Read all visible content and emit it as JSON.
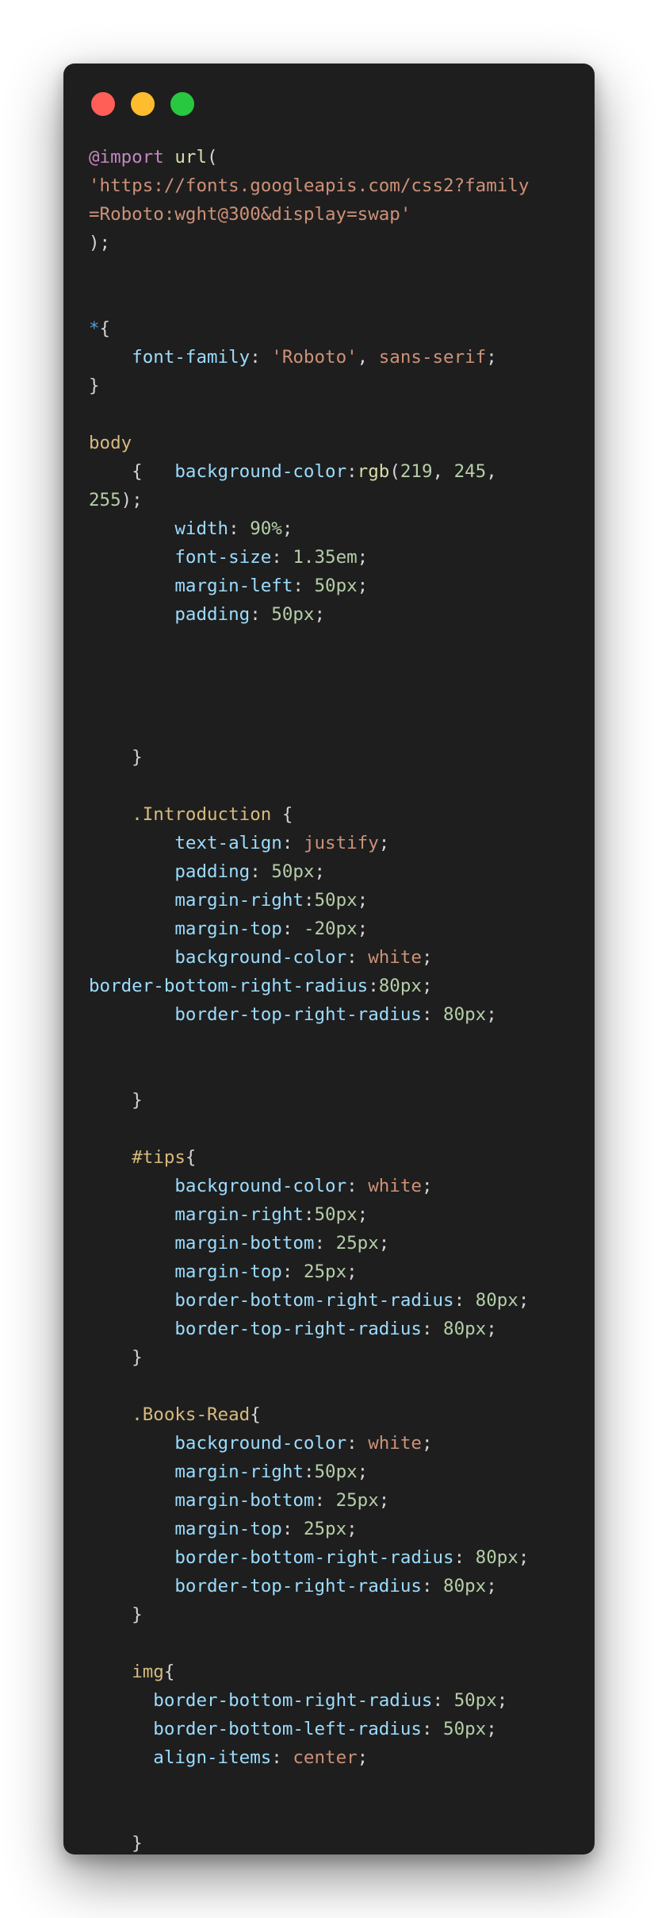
{
  "window": {
    "controls": [
      {
        "name": "close-button",
        "color": "#ff5f57"
      },
      {
        "name": "minimize-button",
        "color": "#febc2e"
      },
      {
        "name": "zoom-button",
        "color": "#28c840"
      }
    ]
  },
  "colors": {
    "background": "#1e1e1e",
    "at_rule": "#c586c0",
    "function": "#dcdcaa",
    "string": "#ce9178",
    "punct": "#d4d4d4",
    "selector": "#d7ba7d",
    "universal": "#569cd6",
    "property": "#9cdcfe",
    "keyword": "#ce9178",
    "number": "#b5cea8"
  },
  "code": {
    "lines": [
      [
        {
          "t": "@import",
          "c": "at_rule"
        },
        {
          "t": " ",
          "c": "punct"
        },
        {
          "t": "url",
          "c": "function"
        },
        {
          "t": "(",
          "c": "punct"
        }
      ],
      [
        {
          "t": "'https://fonts.googleapis.com/css2?family",
          "c": "string"
        }
      ],
      [
        {
          "t": "=Roboto:wght@300&display=swap'",
          "c": "string"
        }
      ],
      [
        {
          "t": ");",
          "c": "punct"
        }
      ],
      [],
      [],
      [
        {
          "t": "*",
          "c": "universal"
        },
        {
          "t": "{",
          "c": "punct"
        }
      ],
      [
        {
          "t": "    ",
          "c": "punct"
        },
        {
          "t": "font-family",
          "c": "property"
        },
        {
          "t": ": ",
          "c": "punct"
        },
        {
          "t": "'Roboto'",
          "c": "string"
        },
        {
          "t": ", ",
          "c": "punct"
        },
        {
          "t": "sans-serif",
          "c": "keyword"
        },
        {
          "t": ";",
          "c": "punct"
        }
      ],
      [
        {
          "t": "}",
          "c": "punct"
        }
      ],
      [],
      [
        {
          "t": "body",
          "c": "selector"
        }
      ],
      [
        {
          "t": "    {   ",
          "c": "punct"
        },
        {
          "t": "background-color",
          "c": "property"
        },
        {
          "t": ":",
          "c": "punct"
        },
        {
          "t": "rgb",
          "c": "function"
        },
        {
          "t": "(",
          "c": "punct"
        },
        {
          "t": "219",
          "c": "number"
        },
        {
          "t": ", ",
          "c": "punct"
        },
        {
          "t": "245",
          "c": "number"
        },
        {
          "t": ",",
          "c": "punct"
        }
      ],
      [
        {
          "t": "255",
          "c": "number"
        },
        {
          "t": ");",
          "c": "punct"
        }
      ],
      [
        {
          "t": "        ",
          "c": "punct"
        },
        {
          "t": "width",
          "c": "property"
        },
        {
          "t": ": ",
          "c": "punct"
        },
        {
          "t": "90%",
          "c": "number"
        },
        {
          "t": ";",
          "c": "punct"
        }
      ],
      [
        {
          "t": "        ",
          "c": "punct"
        },
        {
          "t": "font-size",
          "c": "property"
        },
        {
          "t": ": ",
          "c": "punct"
        },
        {
          "t": "1.35em",
          "c": "number"
        },
        {
          "t": ";",
          "c": "punct"
        }
      ],
      [
        {
          "t": "        ",
          "c": "punct"
        },
        {
          "t": "margin-left",
          "c": "property"
        },
        {
          "t": ": ",
          "c": "punct"
        },
        {
          "t": "50px",
          "c": "number"
        },
        {
          "t": ";",
          "c": "punct"
        }
      ],
      [
        {
          "t": "        ",
          "c": "punct"
        },
        {
          "t": "padding",
          "c": "property"
        },
        {
          "t": ": ",
          "c": "punct"
        },
        {
          "t": "50px",
          "c": "number"
        },
        {
          "t": ";",
          "c": "punct"
        }
      ],
      [],
      [],
      [],
      [],
      [
        {
          "t": "    }",
          "c": "punct"
        }
      ],
      [],
      [
        {
          "t": "    ",
          "c": "punct"
        },
        {
          "t": ".Introduction",
          "c": "selector"
        },
        {
          "t": " {",
          "c": "punct"
        }
      ],
      [
        {
          "t": "        ",
          "c": "punct"
        },
        {
          "t": "text-align",
          "c": "property"
        },
        {
          "t": ": ",
          "c": "punct"
        },
        {
          "t": "justify",
          "c": "keyword"
        },
        {
          "t": ";",
          "c": "punct"
        }
      ],
      [
        {
          "t": "        ",
          "c": "punct"
        },
        {
          "t": "padding",
          "c": "property"
        },
        {
          "t": ": ",
          "c": "punct"
        },
        {
          "t": "50px",
          "c": "number"
        },
        {
          "t": ";",
          "c": "punct"
        }
      ],
      [
        {
          "t": "        ",
          "c": "punct"
        },
        {
          "t": "margin-right",
          "c": "property"
        },
        {
          "t": ":",
          "c": "punct"
        },
        {
          "t": "50px",
          "c": "number"
        },
        {
          "t": ";",
          "c": "punct"
        }
      ],
      [
        {
          "t": "        ",
          "c": "punct"
        },
        {
          "t": "margin-top",
          "c": "property"
        },
        {
          "t": ": ",
          "c": "punct"
        },
        {
          "t": "-20px",
          "c": "number"
        },
        {
          "t": ";",
          "c": "punct"
        }
      ],
      [
        {
          "t": "        ",
          "c": "punct"
        },
        {
          "t": "background-color",
          "c": "property"
        },
        {
          "t": ": ",
          "c": "punct"
        },
        {
          "t": "white",
          "c": "keyword"
        },
        {
          "t": ";",
          "c": "punct"
        }
      ],
      [
        {
          "t": "border-bottom-right-radius",
          "c": "property"
        },
        {
          "t": ":",
          "c": "punct"
        },
        {
          "t": "80px",
          "c": "number"
        },
        {
          "t": ";",
          "c": "punct"
        }
      ],
      [
        {
          "t": "        ",
          "c": "punct"
        },
        {
          "t": "border-top-right-radius",
          "c": "property"
        },
        {
          "t": ": ",
          "c": "punct"
        },
        {
          "t": "80px",
          "c": "number"
        },
        {
          "t": ";",
          "c": "punct"
        }
      ],
      [],
      [],
      [
        {
          "t": "    }",
          "c": "punct"
        }
      ],
      [],
      [
        {
          "t": "    ",
          "c": "punct"
        },
        {
          "t": "#tips",
          "c": "selector"
        },
        {
          "t": "{",
          "c": "punct"
        }
      ],
      [
        {
          "t": "        ",
          "c": "punct"
        },
        {
          "t": "background-color",
          "c": "property"
        },
        {
          "t": ": ",
          "c": "punct"
        },
        {
          "t": "white",
          "c": "keyword"
        },
        {
          "t": ";",
          "c": "punct"
        }
      ],
      [
        {
          "t": "        ",
          "c": "punct"
        },
        {
          "t": "margin-right",
          "c": "property"
        },
        {
          "t": ":",
          "c": "punct"
        },
        {
          "t": "50px",
          "c": "number"
        },
        {
          "t": ";",
          "c": "punct"
        }
      ],
      [
        {
          "t": "        ",
          "c": "punct"
        },
        {
          "t": "margin-bottom",
          "c": "property"
        },
        {
          "t": ": ",
          "c": "punct"
        },
        {
          "t": "25px",
          "c": "number"
        },
        {
          "t": ";",
          "c": "punct"
        }
      ],
      [
        {
          "t": "        ",
          "c": "punct"
        },
        {
          "t": "margin-top",
          "c": "property"
        },
        {
          "t": ": ",
          "c": "punct"
        },
        {
          "t": "25px",
          "c": "number"
        },
        {
          "t": ";",
          "c": "punct"
        }
      ],
      [
        {
          "t": "        ",
          "c": "punct"
        },
        {
          "t": "border-bottom-right-radius",
          "c": "property"
        },
        {
          "t": ": ",
          "c": "punct"
        },
        {
          "t": "80px",
          "c": "number"
        },
        {
          "t": ";",
          "c": "punct"
        }
      ],
      [
        {
          "t": "        ",
          "c": "punct"
        },
        {
          "t": "border-top-right-radius",
          "c": "property"
        },
        {
          "t": ": ",
          "c": "punct"
        },
        {
          "t": "80px",
          "c": "number"
        },
        {
          "t": ";",
          "c": "punct"
        }
      ],
      [
        {
          "t": "    }",
          "c": "punct"
        }
      ],
      [],
      [
        {
          "t": "    ",
          "c": "punct"
        },
        {
          "t": ".Books-Read",
          "c": "selector"
        },
        {
          "t": "{",
          "c": "punct"
        }
      ],
      [
        {
          "t": "        ",
          "c": "punct"
        },
        {
          "t": "background-color",
          "c": "property"
        },
        {
          "t": ": ",
          "c": "punct"
        },
        {
          "t": "white",
          "c": "keyword"
        },
        {
          "t": ";",
          "c": "punct"
        }
      ],
      [
        {
          "t": "        ",
          "c": "punct"
        },
        {
          "t": "margin-right",
          "c": "property"
        },
        {
          "t": ":",
          "c": "punct"
        },
        {
          "t": "50px",
          "c": "number"
        },
        {
          "t": ";",
          "c": "punct"
        }
      ],
      [
        {
          "t": "        ",
          "c": "punct"
        },
        {
          "t": "margin-bottom",
          "c": "property"
        },
        {
          "t": ": ",
          "c": "punct"
        },
        {
          "t": "25px",
          "c": "number"
        },
        {
          "t": ";",
          "c": "punct"
        }
      ],
      [
        {
          "t": "        ",
          "c": "punct"
        },
        {
          "t": "margin-top",
          "c": "property"
        },
        {
          "t": ": ",
          "c": "punct"
        },
        {
          "t": "25px",
          "c": "number"
        },
        {
          "t": ";",
          "c": "punct"
        }
      ],
      [
        {
          "t": "        ",
          "c": "punct"
        },
        {
          "t": "border-bottom-right-radius",
          "c": "property"
        },
        {
          "t": ": ",
          "c": "punct"
        },
        {
          "t": "80px",
          "c": "number"
        },
        {
          "t": ";",
          "c": "punct"
        }
      ],
      [
        {
          "t": "        ",
          "c": "punct"
        },
        {
          "t": "border-top-right-radius",
          "c": "property"
        },
        {
          "t": ": ",
          "c": "punct"
        },
        {
          "t": "80px",
          "c": "number"
        },
        {
          "t": ";",
          "c": "punct"
        }
      ],
      [
        {
          "t": "    }",
          "c": "punct"
        }
      ],
      [],
      [
        {
          "t": "    ",
          "c": "punct"
        },
        {
          "t": "img",
          "c": "selector"
        },
        {
          "t": "{",
          "c": "punct"
        }
      ],
      [
        {
          "t": "      ",
          "c": "punct"
        },
        {
          "t": "border-bottom-right-radius",
          "c": "property"
        },
        {
          "t": ": ",
          "c": "punct"
        },
        {
          "t": "50px",
          "c": "number"
        },
        {
          "t": ";",
          "c": "punct"
        }
      ],
      [
        {
          "t": "      ",
          "c": "punct"
        },
        {
          "t": "border-bottom-left-radius",
          "c": "property"
        },
        {
          "t": ": ",
          "c": "punct"
        },
        {
          "t": "50px",
          "c": "number"
        },
        {
          "t": ";",
          "c": "punct"
        }
      ],
      [
        {
          "t": "      ",
          "c": "punct"
        },
        {
          "t": "align-items",
          "c": "property"
        },
        {
          "t": ": ",
          "c": "punct"
        },
        {
          "t": "center",
          "c": "keyword"
        },
        {
          "t": ";",
          "c": "punct"
        }
      ],
      [],
      [],
      [
        {
          "t": "    }",
          "c": "punct"
        }
      ]
    ]
  }
}
